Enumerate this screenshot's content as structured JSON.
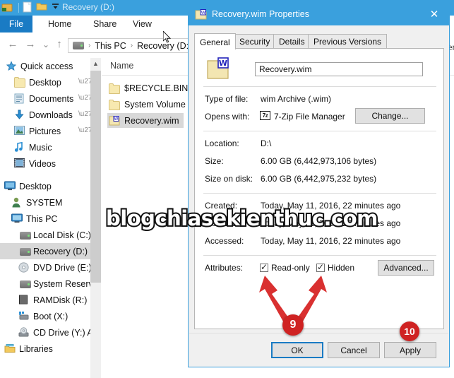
{
  "explorer": {
    "title": "Recovery (D:)",
    "quick_access_icons": [
      "explorer-icon",
      "properties-icon",
      "new-folder-icon",
      "customize-qat-icon"
    ],
    "ribbon_tabs": [
      {
        "label": "File",
        "active": true
      },
      {
        "label": "Home",
        "active": false
      },
      {
        "label": "Share",
        "active": false
      },
      {
        "label": "View",
        "active": false
      }
    ],
    "nav_buttons": {
      "back": "←",
      "forward": "→",
      "recent": "⌄",
      "up": "↑"
    },
    "address": {
      "drive_icon": "drive-icon",
      "crumbs": [
        "This PC",
        "Recovery (D:)"
      ],
      "separator": "›"
    },
    "nav_pane": [
      {
        "label": "Quick access",
        "icon": "star-icon",
        "indent": 0,
        "pinned": false,
        "selected": false
      },
      {
        "label": "Desktop",
        "icon": "folder-icon",
        "indent": 1,
        "pinned": true,
        "selected": false
      },
      {
        "label": "Documents",
        "icon": "documents-icon",
        "indent": 1,
        "pinned": true,
        "selected": false
      },
      {
        "label": "Downloads",
        "icon": "downloads-icon",
        "indent": 1,
        "pinned": true,
        "selected": false
      },
      {
        "label": "Pictures",
        "icon": "pictures-icon",
        "indent": 1,
        "pinned": true,
        "selected": false
      },
      {
        "label": "Music",
        "icon": "music-icon",
        "indent": 1,
        "pinned": false,
        "selected": false
      },
      {
        "label": "Videos",
        "icon": "videos-icon",
        "indent": 1,
        "pinned": false,
        "selected": false
      },
      {
        "label": "Desktop",
        "icon": "desktop-icon",
        "indent": 0,
        "pinned": false,
        "selected": false
      },
      {
        "label": "SYSTEM",
        "icon": "user-icon",
        "indent": 0,
        "pinned": false,
        "selected": false
      },
      {
        "label": "This PC",
        "icon": "thispc-icon",
        "indent": 0,
        "pinned": false,
        "selected": false
      },
      {
        "label": "Local Disk (C:)",
        "icon": "drive-icon",
        "indent": 1,
        "pinned": false,
        "selected": false
      },
      {
        "label": "Recovery (D:)",
        "icon": "drive-icon",
        "indent": 1,
        "pinned": false,
        "selected": true
      },
      {
        "label": "DVD Drive (E:) I",
        "icon": "dvd-icon",
        "indent": 1,
        "pinned": false,
        "selected": false
      },
      {
        "label": "System Reserve",
        "icon": "drive-icon",
        "indent": 1,
        "pinned": false,
        "selected": false
      },
      {
        "label": "RAMDisk (R:)",
        "icon": "ramdisk-icon",
        "indent": 1,
        "pinned": false,
        "selected": false
      },
      {
        "label": "Boot (X:)",
        "icon": "boot-icon",
        "indent": 1,
        "pinned": false,
        "selected": false
      },
      {
        "label": "CD Drive (Y:) A",
        "icon": "cd-icon",
        "indent": 1,
        "pinned": false,
        "selected": false
      },
      {
        "label": "Libraries",
        "icon": "libraries-icon",
        "indent": 0,
        "pinned": false,
        "selected": false
      }
    ],
    "file_list": {
      "column_header": "Name",
      "rows": [
        {
          "name": "$RECYCLE.BIN",
          "icon": "folder-icon",
          "selected": false
        },
        {
          "name": "System Volume I",
          "icon": "folder-icon",
          "selected": false
        },
        {
          "name": "Recovery.wim",
          "icon": "wim-file-icon",
          "selected": true
        }
      ]
    },
    "right_edge_text": "ver"
  },
  "dialog": {
    "title": "Recovery.wim Properties",
    "title_icon": "wim-file-icon",
    "close_label": "✕",
    "tabs": [
      {
        "label": "General",
        "active": true
      },
      {
        "label": "Security",
        "active": false
      },
      {
        "label": "Details",
        "active": false
      },
      {
        "label": "Previous Versions",
        "active": false
      }
    ],
    "filename_value": "Recovery.wim",
    "fields": [
      {
        "label": "Type of file:",
        "value": "wim Archive (.wim)"
      },
      {
        "label": "Opens with:",
        "value": "7-Zip File Manager",
        "icon": "7zip-icon",
        "button": "Change..."
      },
      {
        "label": "Location:",
        "value": "D:\\"
      },
      {
        "label": "Size:",
        "value": "6.00 GB (6,442,973,106 bytes)"
      },
      {
        "label": "Size on disk:",
        "value": "6.00 GB (6,442,975,232 bytes)"
      },
      {
        "label": "Created:",
        "value": "Today, May 11, 2016, 22 minutes ago"
      },
      {
        "label": "Modified:",
        "value": "Today, May 11, 2016, 22 minutes ago"
      },
      {
        "label": "Accessed:",
        "value": "Today, May 11, 2016, 22 minutes ago"
      }
    ],
    "attributes": {
      "label": "Attributes:",
      "readonly": {
        "label": "Read-only",
        "checked": true
      },
      "hidden": {
        "label": "Hidden",
        "checked": true
      },
      "advanced_button": "Advanced..."
    },
    "footer_buttons": [
      {
        "label": "OK",
        "default": true
      },
      {
        "label": "Cancel",
        "default": false
      },
      {
        "label": "Apply",
        "default": false
      }
    ]
  },
  "annotations": {
    "watermark": "blogchiasekienthuc.com",
    "badges": [
      {
        "number": "9"
      },
      {
        "number": "10"
      }
    ],
    "accent_color": "#cf2222",
    "brand_color": "#3aa0dd"
  }
}
